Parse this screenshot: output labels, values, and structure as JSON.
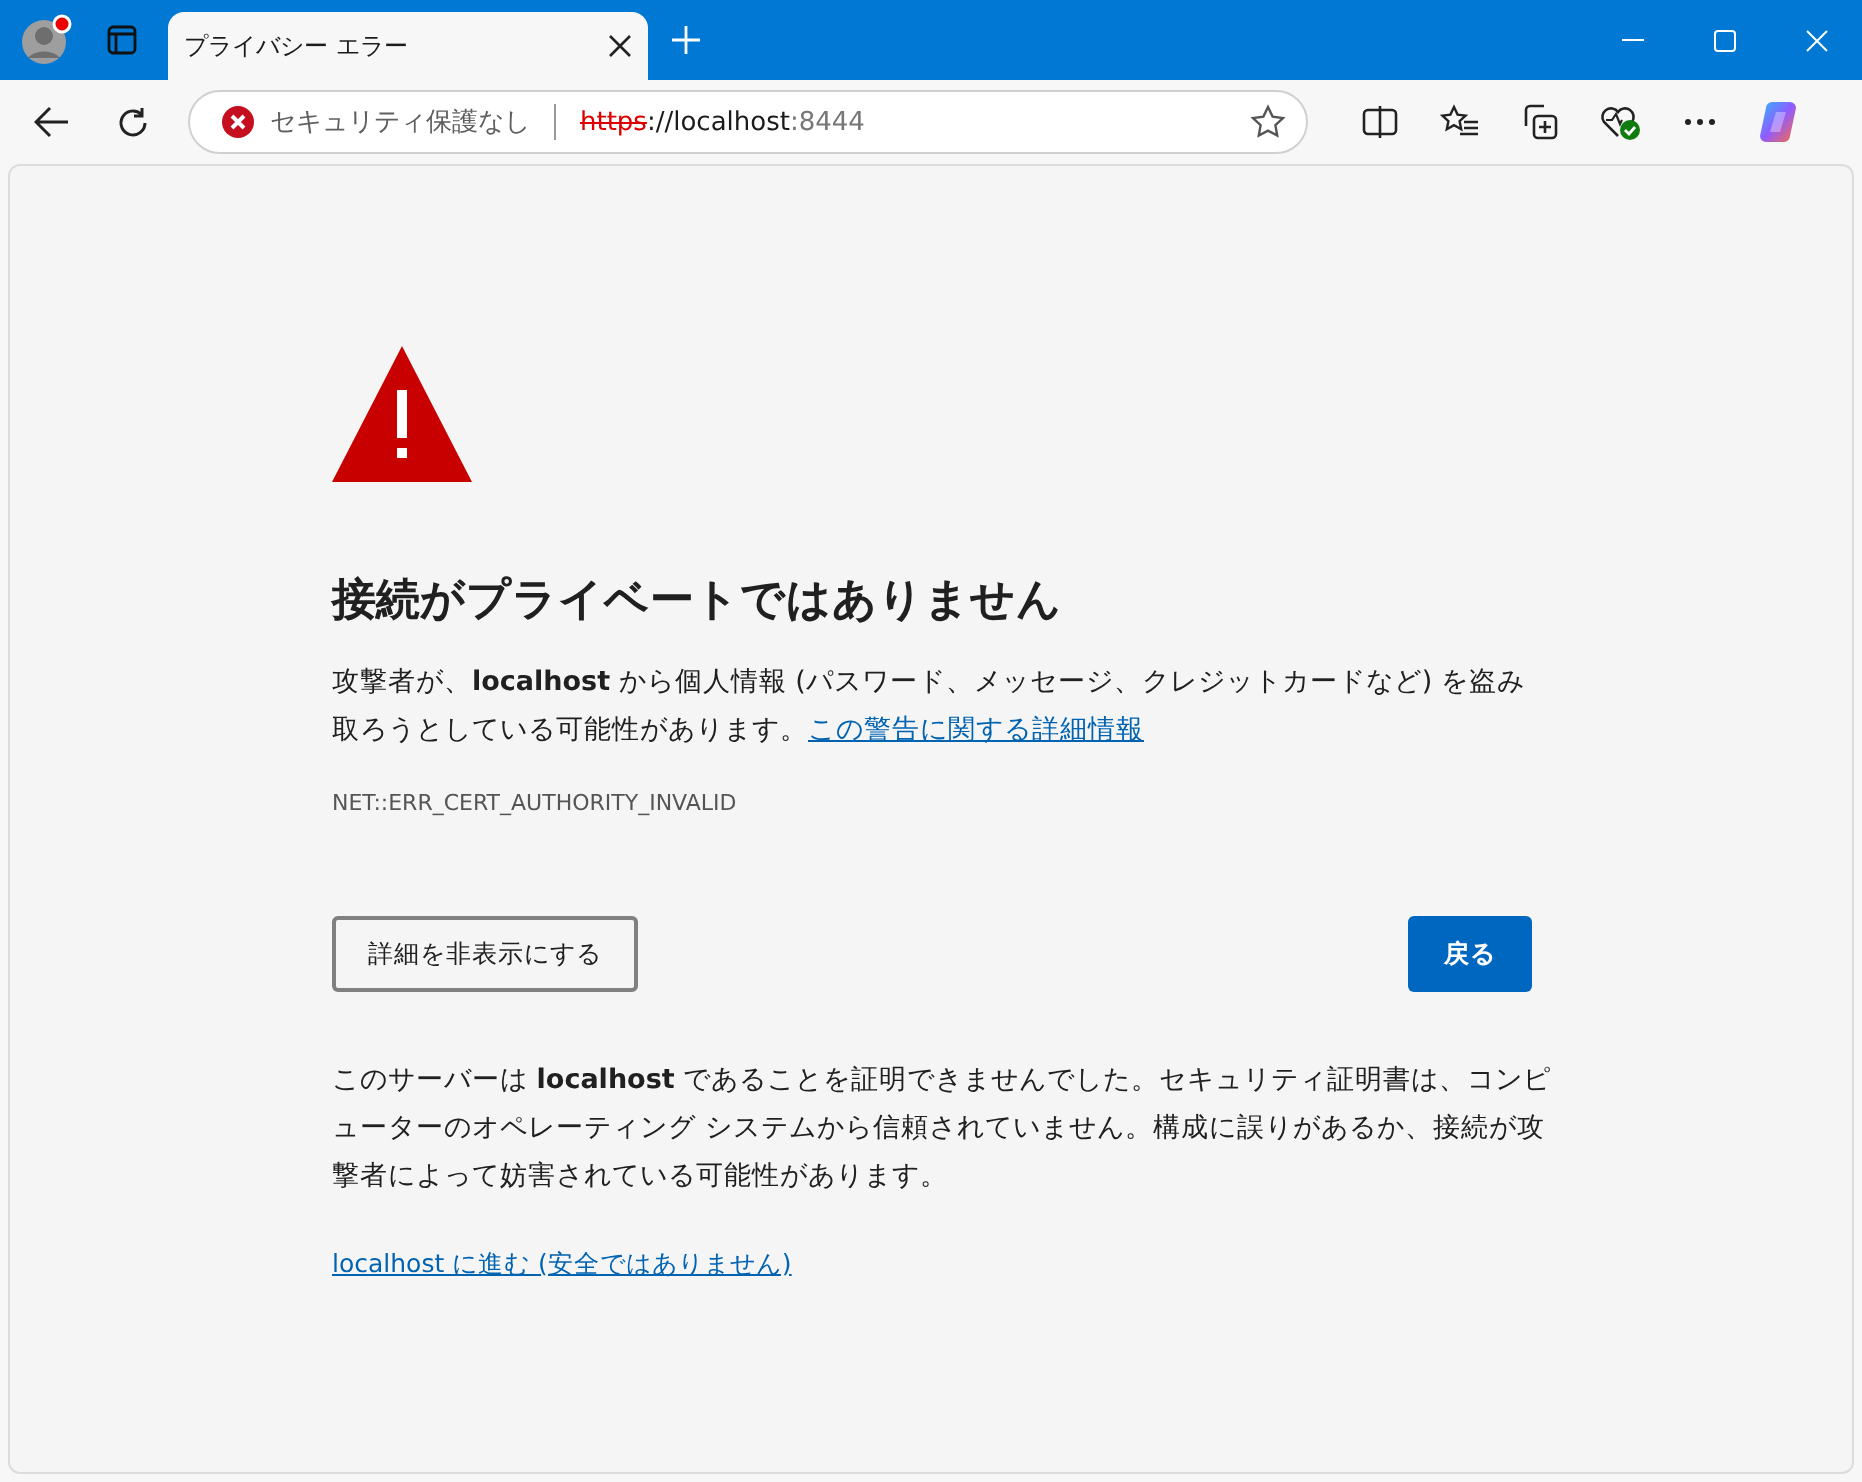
{
  "tab": {
    "title": "プライバシー エラー",
    "selected": true
  },
  "address_bar": {
    "security_label": "セキュリティ保護なし",
    "scheme": "https",
    "host": "://localhost",
    "port": ":8444"
  },
  "page": {
    "heading": "接続がプライベートではありません",
    "warning": "攻撃者が、**localhost** から個人情報 (パスワード、メッセージ、クレジットカードなど) を盗み取ろうとしている可能性があります。",
    "details_link": "この警告に関する詳細情報",
    "error_code": "NET::ERR_CERT_AUTHORITY_INVALID",
    "buttons": [
      {
        "label": "詳細を非表示にする",
        "kind": "secondary"
      },
      {
        "label": "戻る",
        "kind": "primary"
      }
    ],
    "details": "このサーバーは **localhost** であることを証明できませんでした。セキュリティ証明書は、コンピューターのオペレーティング システムから信頼されていません。構成に誤りがあるか、接続が攻撃者によって妨害されている可能性があります。",
    "proceed_link": "localhost に進む (安全ではありません)"
  }
}
